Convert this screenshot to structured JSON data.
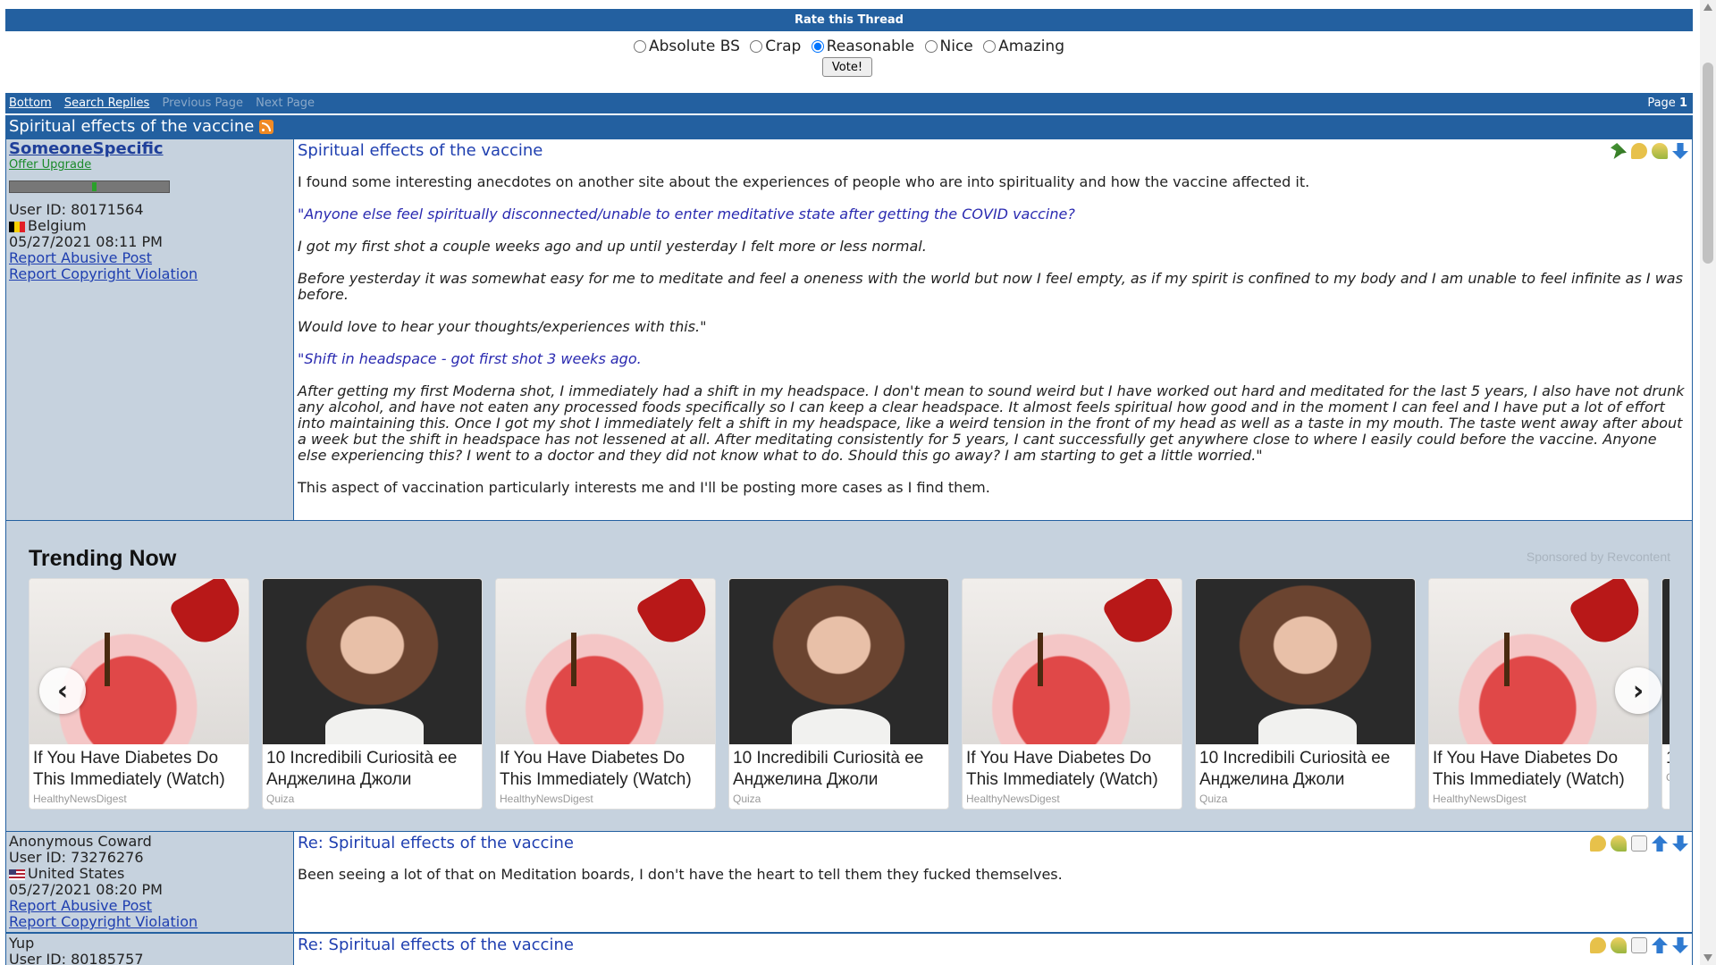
{
  "rate": {
    "header": "Rate this Thread",
    "options": [
      "Absolute BS",
      "Crap",
      "Reasonable",
      "Nice",
      "Amazing"
    ],
    "selected": "Reasonable",
    "vote_label": "Vote!"
  },
  "nav": {
    "bottom": "Bottom",
    "search": "Search Replies",
    "prev": "Previous Page",
    "next": "Next Page",
    "page_label": "Page",
    "page_num": "1"
  },
  "thread": {
    "title": "Spiritual effects of the vaccine"
  },
  "posts": [
    {
      "username": "SomeoneSpecific",
      "offer": "Offer Upgrade",
      "user_id": "User ID: 80171564",
      "country": "Belgium",
      "date": "05/27/2021 08:11 PM",
      "report_abuse": "Report Abusive Post",
      "report_copyright": "Report Copyright Violation",
      "title": "Spiritual effects of the vaccine",
      "paragraphs": [
        "I found some interesting anecdotes on another site about the experiences of people who are into spirituality and how the vaccine affected it.",
        "\"Anyone else feel spiritually disconnected/unable to enter meditative state after getting the COVID vaccine?",
        "I got my first shot a couple weeks ago and up until yesterday I felt more or less normal.",
        "Before yesterday it was somewhat easy for me to meditate and feel a oneness with the world but now I feel empty, as if my spirit is confined to my body and I am unable to feel infinite as I was before.",
        "Would love to hear your thoughts/experiences with this.\"",
        "\"Shift in headspace - got first shot 3 weeks ago.",
        "After getting my first Moderna shot, I immediately had a shift in my headspace. I don't mean to sound weird but I have worked out hard and meditated for the last 5 years, I also have not drunk any alcohol, and have not eaten any processed foods specifically so I can keep a clear headspace. It almost feels spiritual how good and in the moment I can feel and I have put a lot of effort into maintaining this. Once I got my shot I immediately felt a shift in my headspace, like a weird tension in the front of my head as well as a taste in my mouth. The taste went away after about a week but the shift in headspace has not lessened at all. After meditating consistently for 5 years, I cant successfully get anywhere close to where I easily could before the vaccine. Anyone else experiencing this? I went to a doctor and they did not know what to do. Should this go away? I am starting to get a little worried.\"",
        "This aspect of vaccination particularly interests me and I'll be posting more cases as I find them."
      ]
    },
    {
      "username": "Anonymous Coward",
      "user_id": "User ID: 73276276",
      "country": "United States",
      "date": "05/27/2021 08:20 PM",
      "report_abuse": "Report Abusive Post",
      "report_copyright": "Report Copyright Violation",
      "title": "Re: Spiritual effects of the vaccine",
      "body": "Been seeing a lot of that on Meditation boards, I don't have the heart to tell them they fucked themselves."
    },
    {
      "username": "Yup",
      "user_id": "User ID: 80185757",
      "title": "Re: Spiritual effects of the vaccine"
    }
  ],
  "trending": {
    "heading": "Trending Now",
    "sponsor": "Sponsored by Revcontent",
    "cards": [
      {
        "title": "If You Have Diabetes Do This Immediately (Watch)",
        "source": "HealthyNewsDigest",
        "image": "soda"
      },
      {
        "title": "10 Incredibili Curiosità ее Анджелина Джоли",
        "source": "Quiza",
        "image": "face"
      },
      {
        "title": "If You Have Diabetes Do This Immediately (Watch)",
        "source": "HealthyNewsDigest",
        "image": "soda"
      },
      {
        "title": "10 Incredibili Curiosità ее Анджелина Джоли",
        "source": "Quiza",
        "image": "face"
      },
      {
        "title": "If You Have Diabetes Do This Immediately (Watch)",
        "source": "HealthyNewsDigest",
        "image": "soda"
      },
      {
        "title": "10 Incredibili Curiosità ее Анджелина Джоли",
        "source": "Quiza",
        "image": "face"
      },
      {
        "title": "If You Have Diabetes Do This Immediately (Watch)",
        "source": "HealthyNewsDigest",
        "image": "soda"
      },
      {
        "title": "1 А",
        "source": "Q",
        "image": "face"
      }
    ]
  },
  "colors": {
    "bar": "#2360a0",
    "sidebar": "#c6d2de",
    "link": "#1f3fb0",
    "quote": "#2a2ab0"
  }
}
